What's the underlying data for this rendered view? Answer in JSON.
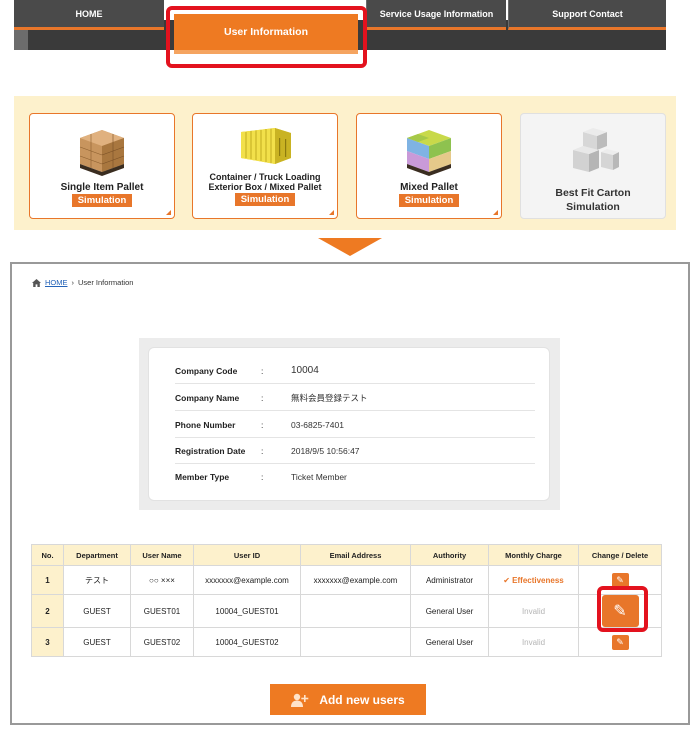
{
  "nav": {
    "home": "HOME",
    "user_info": "User Information",
    "service_usage": "Service Usage Information",
    "support": "Support Contact"
  },
  "simulations": [
    {
      "title": "Single Item Pallet",
      "sim": "Simulation",
      "icon": "boxes-on-pallet-icon"
    },
    {
      "title_1": "Container / Truck Loading",
      "title_2": "Exterior Box / Mixed Pallet",
      "sim": "Simulation",
      "icon": "container-icon"
    },
    {
      "title": "Mixed Pallet",
      "sim": "Simulation",
      "icon": "mixed-pallet-icon"
    },
    {
      "title_1": "Best Fit Carton",
      "title_2": "Simulation",
      "icon": "cartons-icon"
    }
  ],
  "breadcrumb": {
    "home": "HOME",
    "separator": "›",
    "current": "User Information"
  },
  "company": {
    "rows": [
      {
        "label": "Company Code",
        "colon": ":",
        "value": "10004"
      },
      {
        "label": "Company Name",
        "colon": ":",
        "value": "無料会員登録テスト"
      },
      {
        "label": "Phone Number",
        "colon": ":",
        "value": "03-6825-7401"
      },
      {
        "label": "Registration Date",
        "colon": ":",
        "value": "2018/9/5 10:56:47"
      },
      {
        "label": "Member Type",
        "colon": ":",
        "value": "Ticket Member"
      }
    ]
  },
  "table": {
    "headers": [
      "No.",
      "Department",
      "User Name",
      "User ID",
      "Email Address",
      "Authority",
      "Monthly Charge",
      "Change / Delete"
    ],
    "rows": [
      {
        "no": "1",
        "department": "テスト",
        "user_name": "○○ ×××",
        "user_id": "xxxxxxx@example.com",
        "email": "xxxxxxx@example.com",
        "authority": "Administrator",
        "charge": "✔ Effectiveness"
      },
      {
        "no": "2",
        "department": "GUEST",
        "user_name": "GUEST01",
        "user_id": "10004_GUEST01",
        "email": "",
        "authority": "General User",
        "charge": "Invalid"
      },
      {
        "no": "3",
        "department": "GUEST",
        "user_name": "GUEST02",
        "user_id": "10004_GUEST02",
        "email": "",
        "authority": "General User",
        "charge": "Invalid"
      }
    ]
  },
  "add_button": {
    "label": "Add new users",
    "icon": "add-user-icon"
  },
  "colors": {
    "accent": "#ee7a22",
    "highlight": "#e3121e",
    "band": "#fdf1cc",
    "nav": "#4a4a4a"
  }
}
